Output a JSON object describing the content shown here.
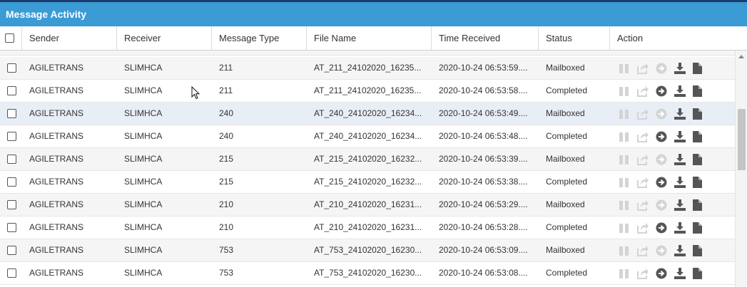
{
  "panel": {
    "title": "Message Activity"
  },
  "columns": [
    "Sender",
    "Receiver",
    "Message Type",
    "File Name",
    "Time Received",
    "Status",
    "Action"
  ],
  "rows": [
    {
      "sender": "AGILETRANS",
      "receiver": "SLIMHCA",
      "type": "211",
      "file": "AT_211_24102020_16235...",
      "time": "2020-10-24 06:53:59....",
      "status": "Mailboxed"
    },
    {
      "sender": "AGILETRANS",
      "receiver": "SLIMHCA",
      "type": "211",
      "file": "AT_211_24102020_16235...",
      "time": "2020-10-24 06:53:58....",
      "status": "Completed"
    },
    {
      "sender": "AGILETRANS",
      "receiver": "SLIMHCA",
      "type": "240",
      "file": "AT_240_24102020_16234...",
      "time": "2020-10-24 06:53:49....",
      "status": "Mailboxed"
    },
    {
      "sender": "AGILETRANS",
      "receiver": "SLIMHCA",
      "type": "240",
      "file": "AT_240_24102020_16234...",
      "time": "2020-10-24 06:53:48....",
      "status": "Completed"
    },
    {
      "sender": "AGILETRANS",
      "receiver": "SLIMHCA",
      "type": "215",
      "file": "AT_215_24102020_16232...",
      "time": "2020-10-24 06:53:39....",
      "status": "Mailboxed"
    },
    {
      "sender": "AGILETRANS",
      "receiver": "SLIMHCA",
      "type": "215",
      "file": "AT_215_24102020_16232...",
      "time": "2020-10-24 06:53:38....",
      "status": "Completed"
    },
    {
      "sender": "AGILETRANS",
      "receiver": "SLIMHCA",
      "type": "210",
      "file": "AT_210_24102020_16231...",
      "time": "2020-10-24 06:53:29....",
      "status": "Mailboxed"
    },
    {
      "sender": "AGILETRANS",
      "receiver": "SLIMHCA",
      "type": "210",
      "file": "AT_210_24102020_16231...",
      "time": "2020-10-24 06:53:28....",
      "status": "Completed"
    },
    {
      "sender": "AGILETRANS",
      "receiver": "SLIMHCA",
      "type": "753",
      "file": "AT_753_24102020_16230...",
      "time": "2020-10-24 06:53:09....",
      "status": "Mailboxed"
    },
    {
      "sender": "AGILETRANS",
      "receiver": "SLIMHCA",
      "type": "753",
      "file": "AT_753_24102020_16230...",
      "time": "2020-10-24 06:53:08....",
      "status": "Completed"
    }
  ],
  "action_icons": [
    "pause-icon",
    "forward-icon",
    "reprocess-icon",
    "download-icon",
    "file-icon"
  ],
  "colors": {
    "title_bar": "#3a9bd5",
    "icon_active": "#555555",
    "icon_disabled": "#d4d4d4",
    "selected_row": "#e8eef6"
  }
}
